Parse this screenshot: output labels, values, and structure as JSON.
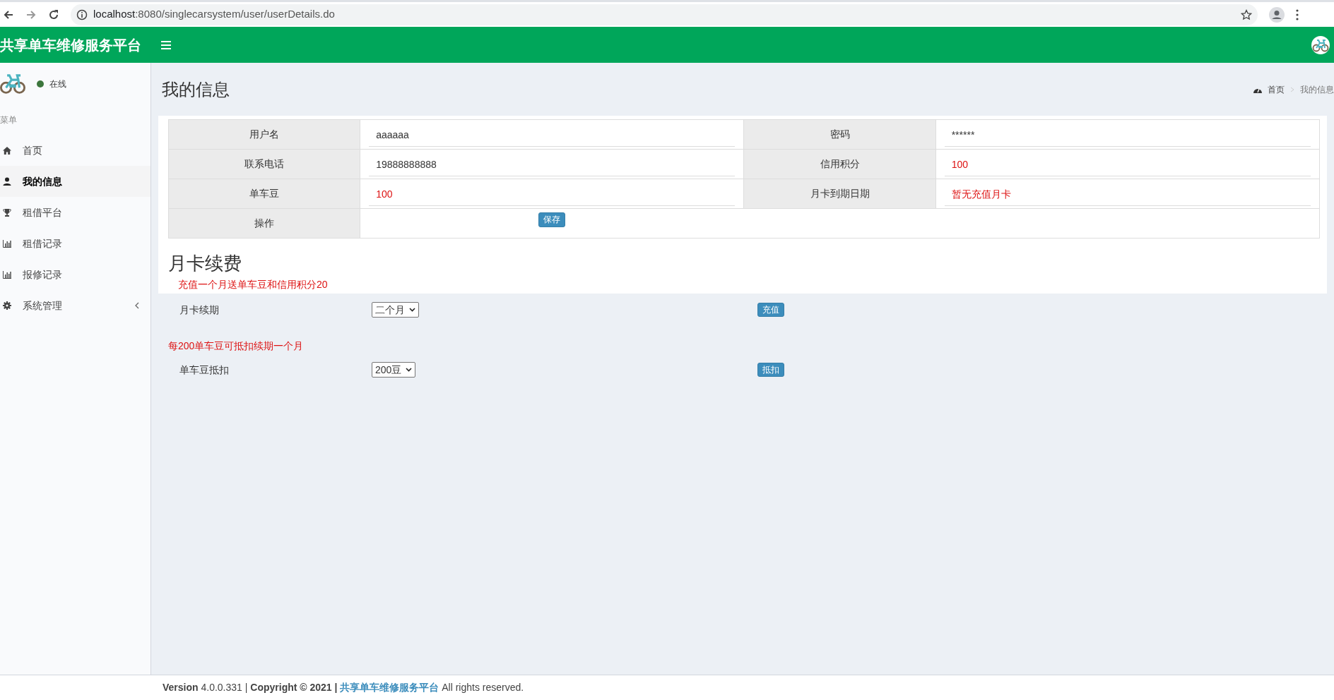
{
  "browser": {
    "url_host": "localhost",
    "url_rest": ":8080/singlecarsystem/user/userDetails.do"
  },
  "header": {
    "title": "共享单车维修服务平台"
  },
  "sidebar": {
    "status": "在线",
    "online": true,
    "menu_heading": "菜单",
    "items": [
      {
        "label": "首页",
        "selected": false,
        "collapsible": false
      },
      {
        "label": "我的信息",
        "selected": true,
        "collapsible": false
      },
      {
        "label": "租借平台",
        "selected": false,
        "collapsible": false
      },
      {
        "label": "租借记录",
        "selected": false,
        "collapsible": false
      },
      {
        "label": "报修记录",
        "selected": false,
        "collapsible": false
      },
      {
        "label": "系统管理",
        "selected": false,
        "collapsible": true
      }
    ]
  },
  "page": {
    "title": "我的信息",
    "breadcrumb": [
      "首页",
      "我的信息"
    ]
  },
  "info_table": {
    "fields": [
      {
        "label": "用户名",
        "value": "aaaaaa",
        "emphasis": false
      },
      {
        "label": "密码",
        "value": "******",
        "emphasis": false
      },
      {
        "label": "联系电话",
        "value": "19888888888",
        "emphasis": false
      },
      {
        "label": "信用积分",
        "value": "100",
        "emphasis": true
      },
      {
        "label": "单车豆",
        "value": "100",
        "emphasis": true
      },
      {
        "label": "月卡到期日期",
        "value": "暂无充值月卡",
        "emphasis": true
      }
    ],
    "action_label": "操作",
    "save_button": "保存"
  },
  "renewal": {
    "title": "月卡续费",
    "sections": [
      {
        "note": "充值一个月送单车豆和信用积分20",
        "label": "月卡续期",
        "select": "二个月",
        "button": "充值"
      },
      {
        "note": "每200单车豆可抵扣续期一个月",
        "label": "单车豆抵扣",
        "select": "200豆",
        "button": "抵扣"
      }
    ]
  },
  "footer": {
    "version_label": "Version",
    "version": "4.0.0.331",
    "separator": "|",
    "copyright": "Copyright © 2021 |",
    "link": "共享单车维修服务平台",
    "rights": "All rights reserved."
  }
}
